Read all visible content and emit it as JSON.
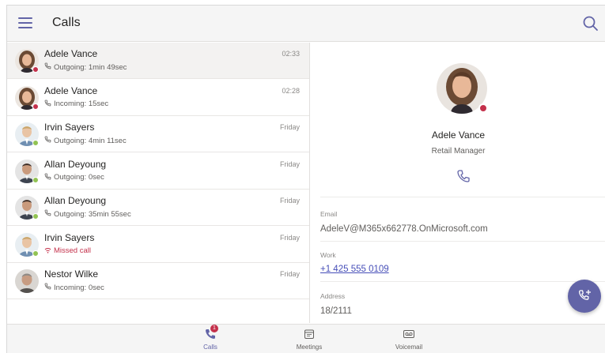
{
  "header": {
    "title": "Calls"
  },
  "calls": [
    {
      "name": "Adele Vance",
      "detail": "Outgoing: 1min 49sec",
      "time": "02:33",
      "missed": false,
      "status": "busy",
      "avatar": "woman-brown-hair"
    },
    {
      "name": "Adele Vance",
      "detail": "Incoming: 15sec",
      "time": "02:28",
      "missed": false,
      "status": "busy",
      "avatar": "woman-brown-hair"
    },
    {
      "name": "Irvin Sayers",
      "detail": "Outgoing: 4min 11sec",
      "time": "Friday",
      "missed": false,
      "status": "available",
      "avatar": "man-blond"
    },
    {
      "name": "Allan Deyoung",
      "detail": "Outgoing: 0sec",
      "time": "Friday",
      "missed": false,
      "status": "available",
      "avatar": "man-dark-hair"
    },
    {
      "name": "Allan Deyoung",
      "detail": "Outgoing: 35min 55sec",
      "time": "Friday",
      "missed": false,
      "status": "available",
      "avatar": "man-dark-hair"
    },
    {
      "name": "Irvin Sayers",
      "detail": "Missed call",
      "time": "Friday",
      "missed": true,
      "status": "available",
      "avatar": "man-blond"
    },
    {
      "name": "Nestor Wilke",
      "detail": "Incoming: 0sec",
      "time": "Friday",
      "missed": false,
      "status": "none",
      "avatar": "man-grey"
    }
  ],
  "contact": {
    "name": "Adele Vance",
    "role": "Retail Manager",
    "email_label": "Email",
    "email": "AdeleV@M365x662778.OnMicrosoft.com",
    "work_label": "Work",
    "work": "+1 425 555 0109",
    "address_label": "Address",
    "address": "18/2111"
  },
  "nav": {
    "calls": "Calls",
    "calls_badge": "1",
    "meetings": "Meetings",
    "voicemail": "Voicemail"
  },
  "colors": {
    "accent": "#6264a7",
    "busy": "#c4314b",
    "available": "#92c353",
    "link": "#464eb8"
  }
}
